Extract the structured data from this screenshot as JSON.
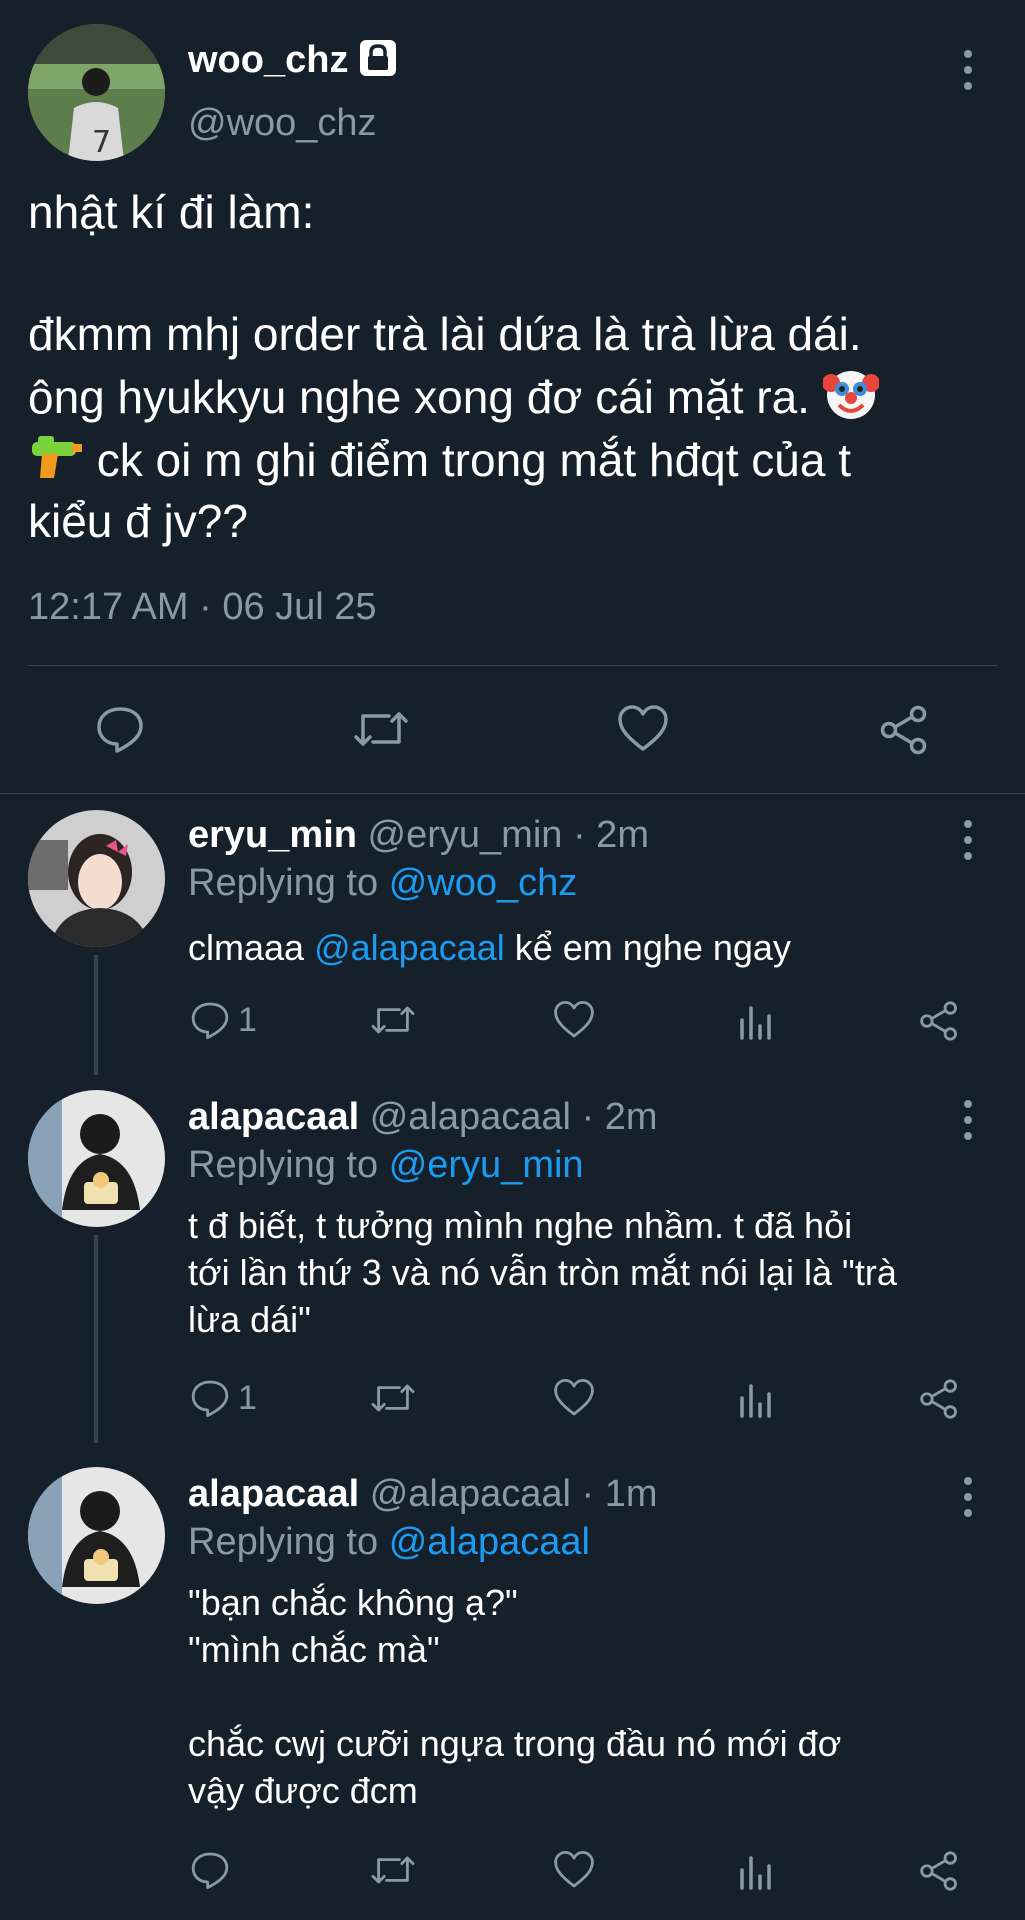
{
  "main_tweet": {
    "display_name": "woo_chz",
    "handle": "@woo_chz",
    "text_line1": "nhật kí đi làm:",
    "text_line2": "đkmm mhj order trà lài dứa là trà lừa dái.",
    "text_line3": "ông hyukkyu nghe xong đơ cái mặt ra.",
    "text_line4": "ck oi m ghi điểm trong mắt hđqt của t",
    "text_line5": "kiểu đ jv??",
    "timestamp": "12:17 AM · 06 Jul 25"
  },
  "replies": [
    {
      "display_name": "eryu_min",
      "handle": "@eryu_min",
      "time": "· 2m",
      "replying_prefix": "Replying to",
      "replying_to": "@woo_chz",
      "body_pre": "clmaaa",
      "body_mention": "@alapacaal",
      "body_post": "kể em nghe ngay",
      "reply_count": "1"
    },
    {
      "display_name": "alapacaal",
      "handle": "@alapacaal",
      "time": "· 2m",
      "replying_prefix": "Replying to",
      "replying_to": "@eryu_min",
      "body_line1": "t đ biết, t tưởng mình nghe nhầm. t đã hỏi",
      "body_line2": "tới lần thứ 3 và nó vẫn tròn mắt nói lại là \"trà",
      "body_line3": "lừa dái\"",
      "reply_count": "1"
    },
    {
      "display_name": "alapacaal",
      "handle": "@alapacaal",
      "time": "· 1m",
      "replying_prefix": "Replying to",
      "replying_to": "@alapacaal",
      "body_line1": "\"bạn chắc không ạ?\"",
      "body_line2": "\"mình chắc mà\"",
      "body_line3": "chắc cwj cưỡi ngựa trong đầu nó mới đơ",
      "body_line4": "vậy được đcm"
    }
  ],
  "icons": {
    "lock": "lock-icon",
    "more": "more-vertical-icon",
    "reply": "reply-icon",
    "retweet": "retweet-icon",
    "like": "heart-icon",
    "stats": "stats-icon",
    "share": "share-icon",
    "clown": "clown-face-emoji",
    "water_pistol": "water-pistol-emoji"
  },
  "colors": {
    "background": "#15202b",
    "text": "#ffffff",
    "muted": "#8b98a5",
    "link": "#1d9bf0",
    "divider": "#38444d"
  }
}
